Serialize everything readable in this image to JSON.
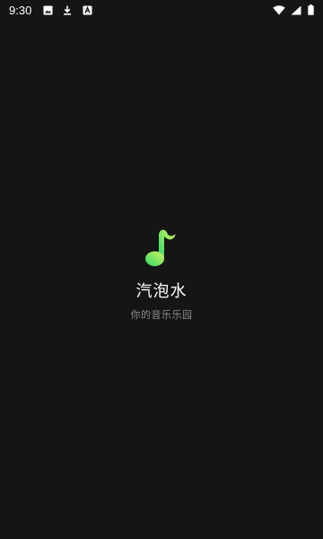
{
  "status_bar": {
    "time": "9:30",
    "left_icons": [
      "image-icon",
      "download-icon",
      "notification-app-icon"
    ],
    "right_icons": [
      "wifi-icon",
      "signal-icon",
      "battery-icon"
    ]
  },
  "splash": {
    "logo_icon": "music-note-icon",
    "app_name": "汽泡水",
    "tagline": "你的音乐乐园",
    "logo_gradient": [
      "#2bd96a",
      "#d8f25a"
    ]
  },
  "colors": {
    "background": "#151515",
    "title": "#ffffff",
    "subtitle": "#8c8c8c"
  }
}
